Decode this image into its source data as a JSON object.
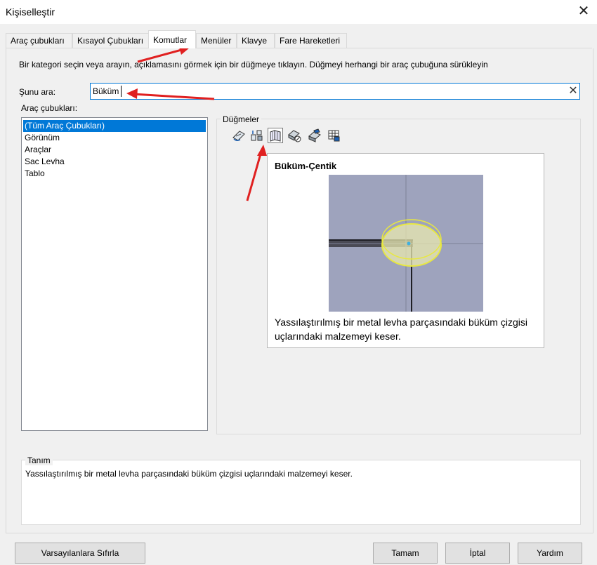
{
  "window": {
    "title": "Kişiselleştir"
  },
  "tabs": [
    {
      "label": "Araç çubukları"
    },
    {
      "label": "Kısayol Çubukları"
    },
    {
      "label": "Komutlar"
    },
    {
      "label": "Menüler"
    },
    {
      "label": "Klavye"
    },
    {
      "label": "Fare Hareketleri"
    }
  ],
  "instructions": "Bir kategori seçin veya arayın, açıklamasını görmek için bir düğmeye tıklayın. Düğmeyi herhangi bir araç çubuğuna sürükleyin",
  "search": {
    "label": "Şunu ara:",
    "value": "Büküm"
  },
  "categories": {
    "label": "Araç çubukları:",
    "items": [
      "(Tüm Araç Çubukları)",
      "Görünüm",
      "Araçlar",
      "Sac Levha",
      "Tablo"
    ],
    "selected": "(Tüm Araç Çubukları)"
  },
  "buttons_group": {
    "label": "Düğmeler",
    "icons": [
      "unfold-bend-icon",
      "flatten-icon",
      "bend-notch-icon",
      "sheet-metal-tool-icon",
      "forming-tool-icon",
      "table-icon"
    ],
    "hovered_icon": "bend-notch-icon"
  },
  "tooltip": {
    "title": "Büküm-Çentik",
    "description": "Yassılaştırılmış bir metal levha parçasındaki büküm çizgisi uçlarındaki malzemeyi keser."
  },
  "description": {
    "label": "Tanım",
    "text": "Yassılaştırılmış bir metal levha parçasındaki büküm çizgisi uçlarındaki malzemeyi keser."
  },
  "footer": {
    "reset_label": "Varsayılanlara Sıfırla",
    "ok_label": "Tamam",
    "cancel_label": "İptal",
    "help_label": "Yardım"
  },
  "colors": {
    "selection": "#0078d7",
    "annotation_arrow": "#e02020",
    "highlight": "#e8e840"
  }
}
